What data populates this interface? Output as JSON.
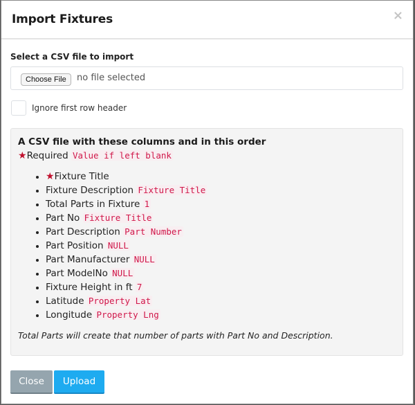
{
  "modal": {
    "title": "Import Fixtures",
    "close_icon": "×"
  },
  "form": {
    "file_label": "Select a CSV file to import",
    "choose_file_button": "Choose File",
    "file_status": "no file selected",
    "ignore_header_label": "Ignore first row header",
    "ignore_header_checked": false
  },
  "info": {
    "title": "A CSV file with these columns and in this order",
    "legend_required": "Required",
    "legend_default": "Value if left blank",
    "star_icon": "★",
    "columns": [
      {
        "name": "Fixture Title",
        "required": true,
        "default": ""
      },
      {
        "name": "Fixture Description",
        "required": false,
        "default": "Fixture Title"
      },
      {
        "name": "Total Parts in Fixture",
        "required": false,
        "default": "1"
      },
      {
        "name": "Part No",
        "required": false,
        "default": "Fixture Title"
      },
      {
        "name": "Part Description",
        "required": false,
        "default": "Part Number"
      },
      {
        "name": "Part Position",
        "required": false,
        "default": "NULL"
      },
      {
        "name": "Part Manufacturer",
        "required": false,
        "default": "NULL"
      },
      {
        "name": "Part ModelNo",
        "required": false,
        "default": "NULL"
      },
      {
        "name": "Fixture Height in ft",
        "required": false,
        "default": "7"
      },
      {
        "name": "Latitude",
        "required": false,
        "default": "Property Lat"
      },
      {
        "name": "Longitude",
        "required": false,
        "default": "Property Lng"
      }
    ],
    "footnote": "Total Parts will create that number of parts with Part No and Description."
  },
  "footer": {
    "close_button": "Close",
    "upload_button": "Upload"
  },
  "colors": {
    "required_star": "#c0102d",
    "code_text": "#d0174a",
    "close_button_bg": "#95a5ae",
    "upload_button_bg": "#1eabf0"
  }
}
